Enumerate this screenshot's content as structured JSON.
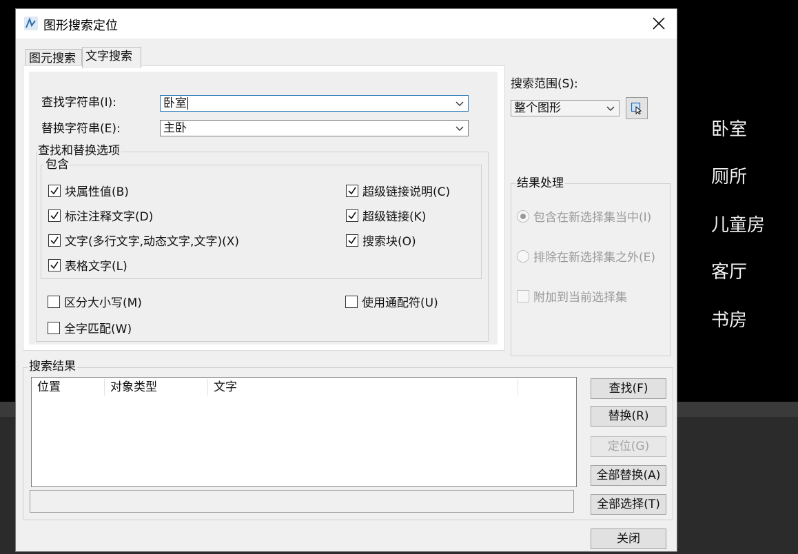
{
  "dialog": {
    "title": "图形搜索定位",
    "tabs": [
      {
        "label": "图元搜索",
        "active": false
      },
      {
        "label": "文字搜索",
        "active": true
      }
    ],
    "find": {
      "label": "查找字符串(I):",
      "value": "卧室"
    },
    "replace": {
      "label": "替换字符串(E):",
      "value": "主卧"
    },
    "options_group": {
      "title": "查找和替换选项",
      "include_title": "包含",
      "include_items": [
        {
          "label": "块属性值(B)",
          "checked": true
        },
        {
          "label": "超级链接说明(C)",
          "checked": true
        },
        {
          "label": "标注注释文字(D)",
          "checked": true
        },
        {
          "label": "超级链接(K)",
          "checked": true
        },
        {
          "label": "文字(多行文字,动态文字,文字)(X)",
          "checked": true
        },
        {
          "label": "搜索块(O)",
          "checked": true
        },
        {
          "label": "表格文字(L)",
          "checked": true
        }
      ],
      "other_items": [
        {
          "label": "区分大小写(M)",
          "checked": false
        },
        {
          "label": "使用通配符(U)",
          "checked": false
        },
        {
          "label": "全字匹配(W)",
          "checked": false
        }
      ]
    },
    "search_scope": {
      "label": "搜索范围(S):",
      "value": "整个图形"
    },
    "result_handling": {
      "title": "结果处理",
      "options": [
        {
          "label": "包含在新选择集当中(I)",
          "type": "radio",
          "selected": true
        },
        {
          "label": "排除在新选择集之外(E)",
          "type": "radio",
          "selected": false
        },
        {
          "label": "附加到当前选择集",
          "type": "checkbox",
          "checked": false
        }
      ]
    },
    "results": {
      "title": "搜索结果",
      "columns": [
        "位置",
        "对象类型",
        "文字"
      ]
    },
    "buttons": {
      "find": "查找(F)",
      "replace": "替换(R)",
      "locate": "定位(G)",
      "replace_all": "全部替换(A)",
      "select_all": "全部选择(T)",
      "close": "关闭"
    }
  },
  "canvas_texts": [
    "卧室",
    "厕所",
    "儿童房",
    "客厅",
    "书房"
  ]
}
